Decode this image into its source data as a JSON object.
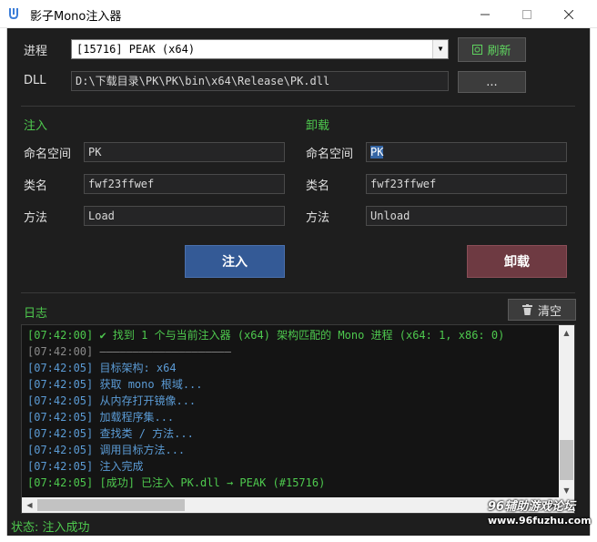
{
  "window": {
    "title": "影子Mono注入器",
    "minimize_glyph": "—",
    "maximize_glyph": "☐",
    "close_glyph": "✕"
  },
  "process": {
    "label": "进程",
    "selected": "[15716] PEAK (x64)",
    "refresh_label": "刷新",
    "refresh_icon": "refresh-icon"
  },
  "dll": {
    "label": "DLL",
    "path": "D:\\下载目录\\PK\\PK\\bin\\x64\\Release\\PK.dll",
    "browse_label": "..."
  },
  "inject": {
    "header": "注入",
    "namespace_label": "命名空间",
    "namespace_value": "PK",
    "class_label": "类名",
    "class_value": "fwf23ffwef",
    "method_label": "方法",
    "method_value": "Load",
    "button_label": "注入"
  },
  "unload": {
    "header": "卸载",
    "namespace_label": "命名空间",
    "namespace_value": "PK",
    "class_label": "类名",
    "class_value": "fwf23ffwef",
    "method_label": "方法",
    "method_value": "Unload",
    "button_label": "卸载"
  },
  "log": {
    "header": "日志",
    "clear_label": "清空",
    "clear_icon": "trash-icon",
    "lines": [
      {
        "text": "[07:42:00] ✔ 找到 1 个与当前注入器 (x64) 架构匹配的 Mono 进程 (x64: 1, x86: 0)",
        "color": "green"
      },
      {
        "text": "[07:42:00] ————————————————————",
        "color": "gray"
      },
      {
        "text": "[07:42:05] 目标架构: x64",
        "color": "blue"
      },
      {
        "text": "[07:42:05] 获取 mono 根域...",
        "color": "blue"
      },
      {
        "text": "[07:42:05] 从内存打开镜像...",
        "color": "blue"
      },
      {
        "text": "[07:42:05] 加载程序集...",
        "color": "blue"
      },
      {
        "text": "[07:42:05] 查找类 / 方法...",
        "color": "blue"
      },
      {
        "text": "[07:42:05] 调用目标方法...",
        "color": "blue"
      },
      {
        "text": "[07:42:05] 注入完成",
        "color": "blue"
      },
      {
        "text": "[07:42:05] [成功] 已注入 PK.dll → PEAK (#15716)",
        "color": "green"
      }
    ]
  },
  "status": "状态: 注入成功",
  "watermark": {
    "line1": "96辅助游戏论坛",
    "line2": "www.96fuzhu.com"
  },
  "colors": {
    "background": "#1e1e1e",
    "accent_green": "#4ec94e",
    "log_blue": "#5b9bd5",
    "inject_button": "#345a96",
    "unload_button": "#6e3a42"
  }
}
